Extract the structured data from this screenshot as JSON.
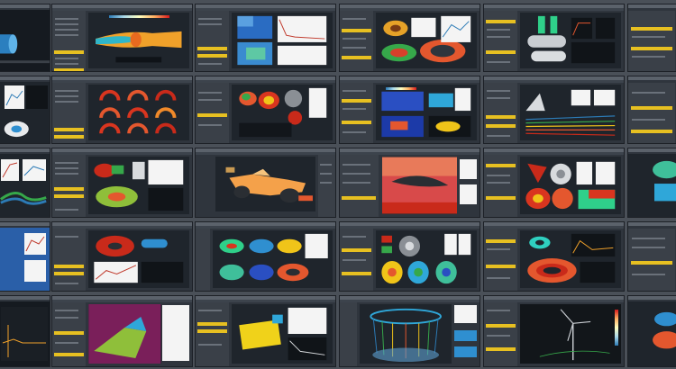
{
  "page": {
    "description_hidden": ""
  },
  "tiles": [
    {
      "id": "r1c1",
      "title": "",
      "scene": "blue-cylinder"
    },
    {
      "id": "r1c2",
      "title": "",
      "scene": "orange-nozzle"
    },
    {
      "id": "r1c3",
      "title": "",
      "scene": "contour-panels"
    },
    {
      "id": "r1c4",
      "title": "",
      "scene": "turbine-rings"
    },
    {
      "id": "r1c5",
      "title": "",
      "scene": "green-pipes"
    },
    {
      "id": "r1c6",
      "title": "",
      "scene": "partial"
    },
    {
      "id": "r2c1",
      "title": "",
      "scene": "plots-and-fan"
    },
    {
      "id": "r2c2",
      "title": "",
      "scene": "red-arcs-grid"
    },
    {
      "id": "r2c3",
      "title": "",
      "scene": "colored-blobs"
    },
    {
      "id": "r2c4",
      "title": "",
      "scene": "blue-panels"
    },
    {
      "id": "r2c5",
      "title": "",
      "scene": "terrain-streamlines"
    },
    {
      "id": "r2c6",
      "title": "",
      "scene": "partial"
    },
    {
      "id": "r3c1",
      "title": "",
      "scene": "plots-rainbow"
    },
    {
      "id": "r3c2",
      "title": "",
      "scene": "pump-volute"
    },
    {
      "id": "r3c3",
      "title": "",
      "scene": "race-car"
    },
    {
      "id": "r3c4",
      "title": "",
      "scene": "airfoil-red"
    },
    {
      "id": "r3c5",
      "title": "",
      "scene": "fan-cones"
    },
    {
      "id": "r3c6",
      "title": "",
      "scene": "partial-cyan"
    },
    {
      "id": "r4c1",
      "title": "",
      "scene": "plots-blue"
    },
    {
      "id": "r4c2",
      "title": "",
      "scene": "rotor-red"
    },
    {
      "id": "r4c3",
      "title": "",
      "scene": "multi-rings"
    },
    {
      "id": "r4c4",
      "title": "",
      "scene": "impellers"
    },
    {
      "id": "r4c5",
      "title": "",
      "scene": "torus-stack"
    },
    {
      "id": "r4c6",
      "title": "",
      "scene": "partial"
    },
    {
      "id": "r5c1",
      "title": "",
      "scene": "plot-dark"
    },
    {
      "id": "r5c2",
      "title": "",
      "scene": "magenta-block"
    },
    {
      "id": "r5c3",
      "title": "",
      "scene": "yellow-radiator"
    },
    {
      "id": "r5c4",
      "title": "",
      "scene": "cylinder-lines"
    },
    {
      "id": "r5c5",
      "title": "",
      "scene": "wind-turbine"
    },
    {
      "id": "r5c6",
      "title": "",
      "scene": "partial"
    }
  ]
}
